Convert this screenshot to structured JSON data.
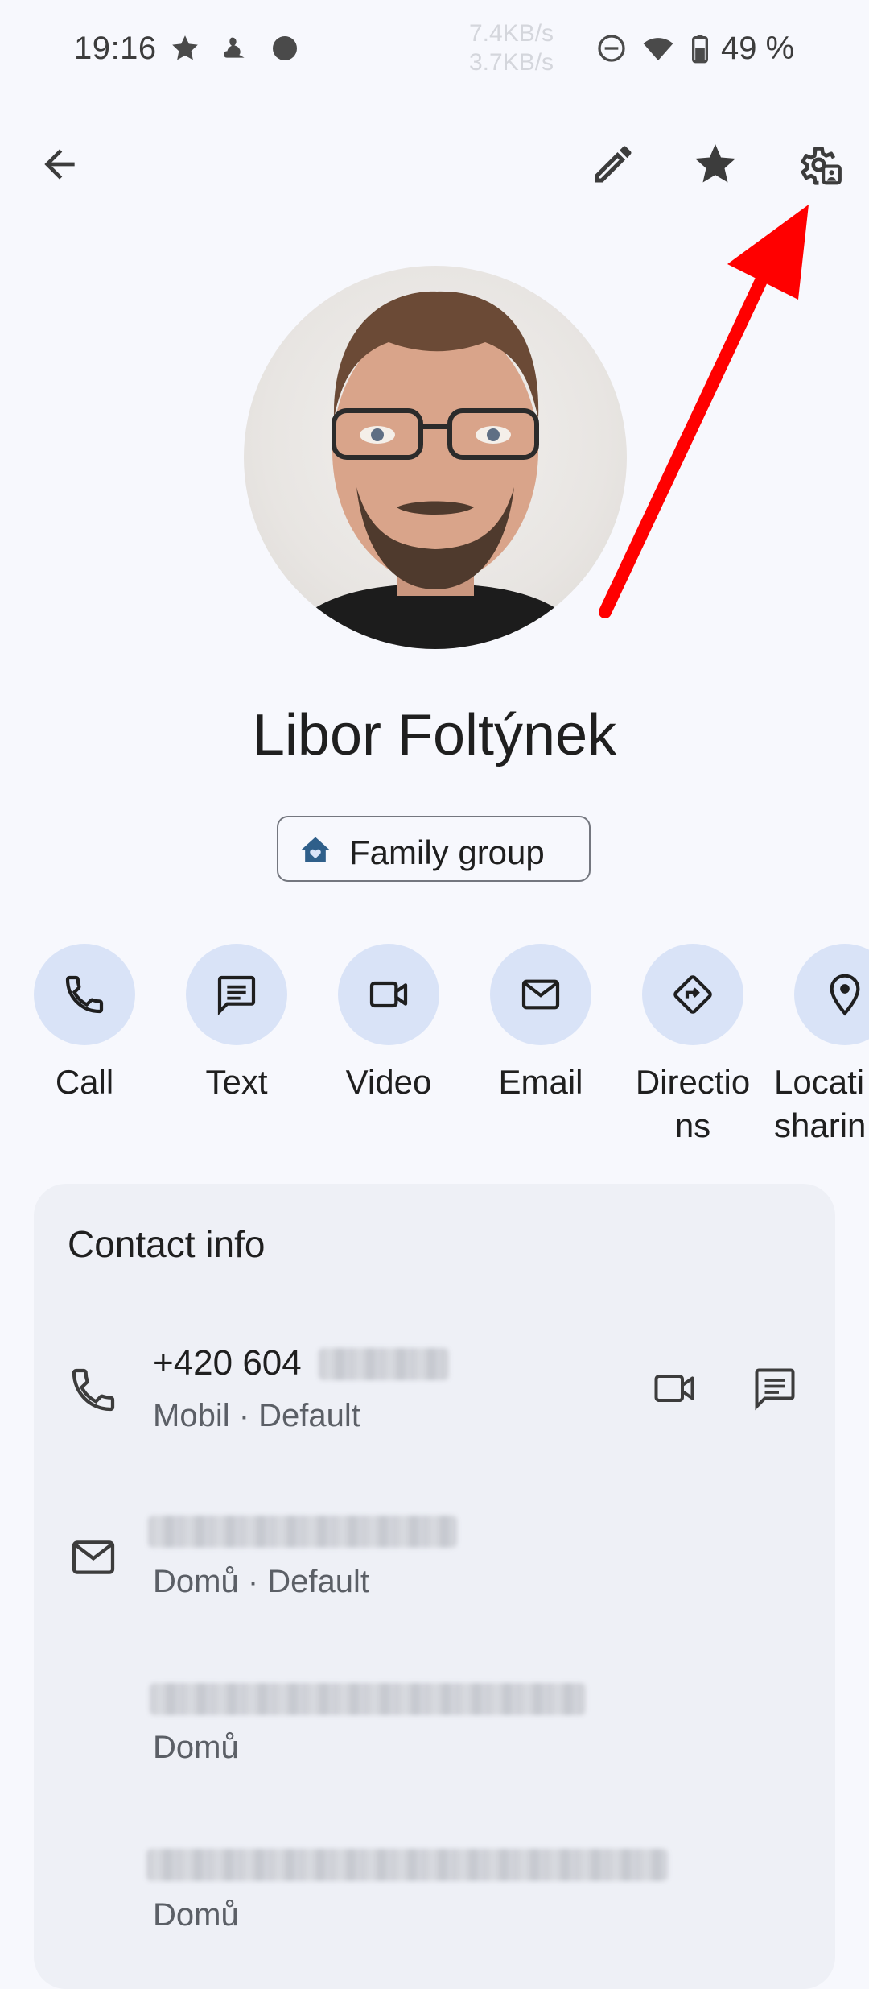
{
  "status_bar": {
    "time": "19:16",
    "net_up": "7.4KB/s",
    "net_down": "3.7KB/s",
    "battery": "49 %",
    "icons": [
      "star-icon",
      "app-notification-icon",
      "circle-icon",
      "do-not-disturb-icon",
      "wifi-icon",
      "battery-icon"
    ]
  },
  "toolbar": {
    "back": "back-arrow-icon",
    "edit": "edit-pencil-icon",
    "favorite": "star-icon",
    "settings": "contact-settings-icon"
  },
  "contact": {
    "name": "Libor Foltýnek",
    "group_chip": "Family group"
  },
  "actions": [
    {
      "label": "Call",
      "icon": "phone-icon"
    },
    {
      "label": "Text",
      "icon": "message-icon"
    },
    {
      "label": "Video",
      "icon": "video-icon"
    },
    {
      "label": "Email",
      "icon": "mail-icon"
    },
    {
      "label": "Directio\nns",
      "icon": "directions-icon"
    },
    {
      "label": "Locati\nsharin",
      "icon": "location-pin-icon"
    }
  ],
  "contact_info": {
    "title": "Contact info",
    "phone": {
      "value": "+420 604",
      "type": "Mobil · Default"
    },
    "emails": [
      {
        "type": "Domů · Default"
      },
      {
        "type": "Domů"
      },
      {
        "type": "Domů"
      }
    ]
  },
  "colors": {
    "background": "#f7f8fd",
    "action_circle": "#d9e3f7",
    "card": "#eef0f6",
    "annotation_arrow": "#ff0000"
  }
}
